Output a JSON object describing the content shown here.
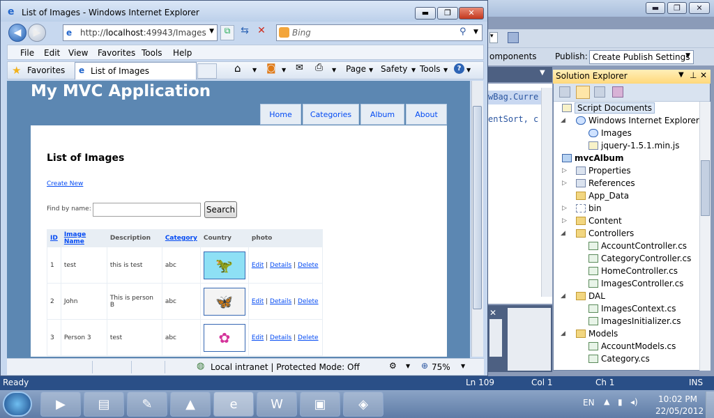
{
  "browser": {
    "title": "List of Images - Windows Internet Explorer",
    "url_prefix": "http://",
    "url_host": "localhost",
    "url_rest": ":49943/Images",
    "search_provider": "Bing",
    "menu": [
      "File",
      "Edit",
      "View",
      "Favorites",
      "Tools",
      "Help"
    ],
    "favorites_label": "Favorites",
    "tab_title": "List of Images",
    "commands": [
      "Page",
      "Safety",
      "Tools"
    ],
    "status_zone": "Local intranet | Protected Mode: Off",
    "zoom": "75%"
  },
  "site": {
    "title": "My MVC Application",
    "nav": [
      "Home",
      "Categories",
      "Album",
      "About"
    ],
    "heading": "List of Images",
    "create_link": "Create New",
    "find_label": "Find by name:",
    "search_button": "Search",
    "columns": [
      "ID",
      "Image Name",
      "Description",
      "Category",
      "Country",
      "photo"
    ],
    "rows": [
      {
        "id": "1",
        "name": "test",
        "desc": "this is test",
        "cat": "abc",
        "country": "",
        "photo": "dinosaur"
      },
      {
        "id": "2",
        "name": "John",
        "desc": "This is person B",
        "cat": "abc",
        "country": "",
        "photo": "butterfly"
      },
      {
        "id": "3",
        "name": "Person 3",
        "desc": "test",
        "cat": "abc",
        "country": "",
        "photo": "flower"
      }
    ],
    "actions": [
      "Edit",
      "Details",
      "Delete"
    ]
  },
  "vs": {
    "toolbar_text": "omponents",
    "publish_label": "Publish:",
    "publish_value": "Create Publish Settings",
    "code_line1": "wBag.Curre",
    "code_line2": "entSort, c",
    "solution_explorer": "Solution Explorer",
    "tree": [
      "Script Documents",
      "Windows Internet Explorer",
      "Images",
      "jquery-1.5.1.min.js",
      "mvcAlbum",
      "Properties",
      "References",
      "App_Data",
      "bin",
      "Content",
      "Controllers",
      "AccountController.cs",
      "CategoryController.cs",
      "HomeController.cs",
      "ImagesController.cs",
      "DAL",
      "ImagesContext.cs",
      "ImagesInitializer.cs",
      "Models",
      "AccountModels.cs",
      "Category.cs"
    ],
    "status": {
      "ready": "Ready",
      "ln": "Ln 109",
      "col": "Col 1",
      "ch": "Ch 1",
      "mode": "INS"
    }
  },
  "taskbar": {
    "lang": "EN",
    "time": "10:02 PM",
    "date": "22/05/2012"
  }
}
